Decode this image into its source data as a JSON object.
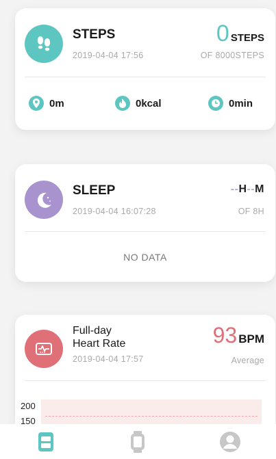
{
  "steps": {
    "title": "STEPS",
    "datetime": "2019-04-04 17:56",
    "value": "0",
    "unit": "STEPS",
    "goal": "OF 8000STEPS",
    "distance": "0m",
    "calories": "0kcal",
    "duration": "0min"
  },
  "sleep": {
    "title": "SLEEP",
    "datetime": "2019-04-04 16:07:28",
    "hours": "--",
    "hours_unit": "H",
    "minutes": "--",
    "minutes_unit": "M",
    "goal": "OF 8H",
    "no_data": "NO DATA"
  },
  "heart_rate": {
    "title_line1": "Full-day",
    "title_line2": "Heart Rate",
    "datetime": "2019-04-04 17:57",
    "value": "93",
    "unit": "BPM",
    "caption": "Average",
    "y_ticks": [
      "200",
      "150"
    ]
  },
  "colors": {
    "steps_accent": "#5ec6c0",
    "sleep_accent": "#a893cf",
    "heart_accent": "#e07078"
  },
  "nav": {
    "items": [
      "dashboard-icon",
      "watch-icon",
      "profile-icon"
    ]
  }
}
